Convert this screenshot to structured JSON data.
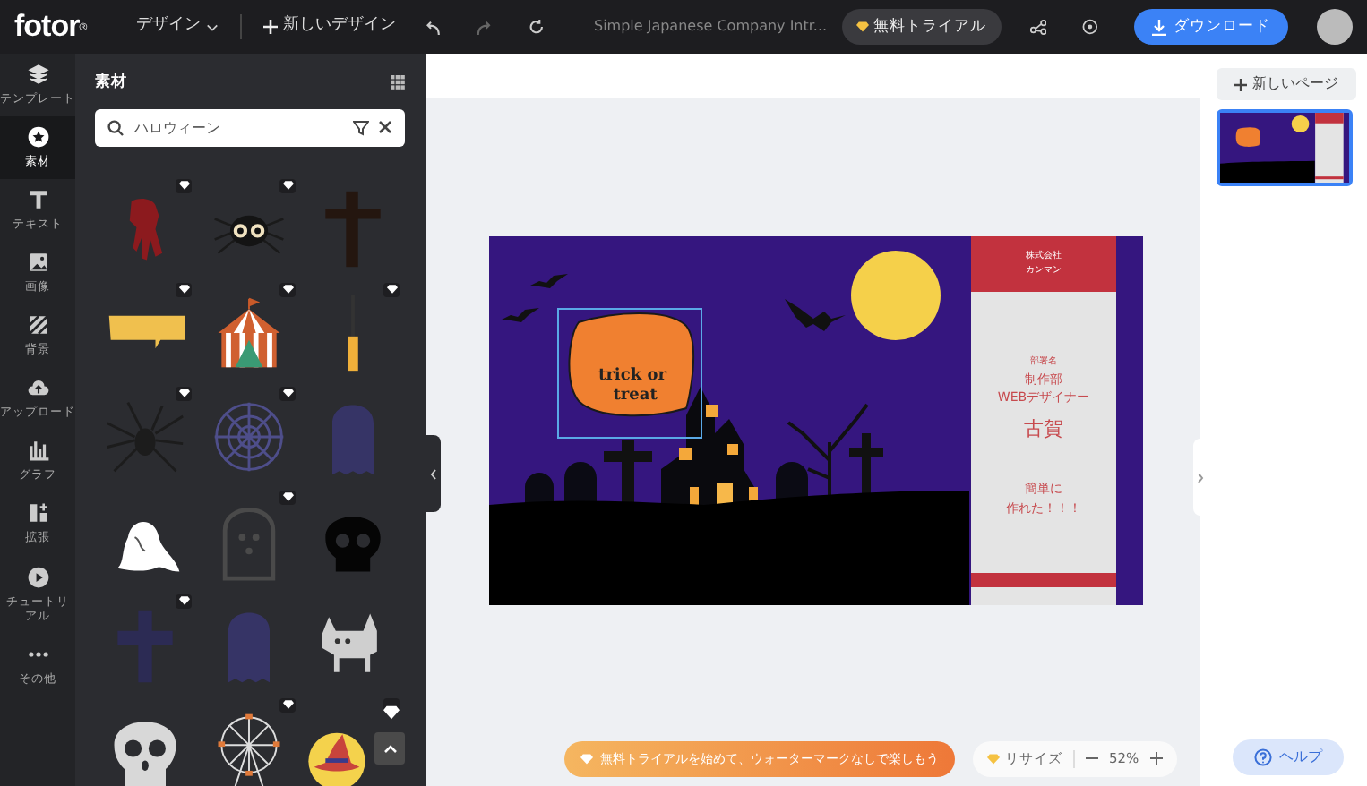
{
  "top_bar": {
    "logo": "fotor",
    "logo_mark": "®",
    "design_menu": "デザイン",
    "new_design": "新しいデザイン",
    "document_title": "Simple Japanese Company Intr...",
    "trial_button": "無料トライアル",
    "download_button": "ダウンロード"
  },
  "rail": [
    {
      "kind": "layers",
      "label": "テンプレート",
      "selected": false
    },
    {
      "kind": "star",
      "label": "素材",
      "selected": true
    },
    {
      "kind": "text",
      "label": "テキスト",
      "selected": false
    },
    {
      "kind": "image",
      "label": "画像",
      "selected": false
    },
    {
      "kind": "stripes",
      "label": "背景",
      "selected": false
    },
    {
      "kind": "cloud",
      "label": "アップロード",
      "selected": false
    },
    {
      "kind": "chart",
      "label": "グラフ",
      "selected": false
    },
    {
      "kind": "apps",
      "label": "拡張",
      "selected": false
    },
    {
      "kind": "play",
      "label": "チュートリアル",
      "selected": false
    },
    {
      "kind": "dots",
      "label": "その他",
      "selected": false
    }
  ],
  "panel": {
    "title": "素材",
    "search": {
      "value": "ハロウィーン"
    },
    "elements": [
      {
        "kind": "blood",
        "premium": true
      },
      {
        "kind": "spider-eyes",
        "premium": true
      },
      {
        "kind": "cross",
        "premium": false
      },
      {
        "kind": "banner",
        "premium": true
      },
      {
        "kind": "circus-tent",
        "premium": true
      },
      {
        "kind": "brush",
        "premium": true
      },
      {
        "kind": "spider",
        "premium": true
      },
      {
        "kind": "web",
        "premium": true
      },
      {
        "kind": "cloth",
        "premium": false
      },
      {
        "kind": "ghost",
        "premium": false
      },
      {
        "kind": "tombstone",
        "premium": true
      },
      {
        "kind": "skull",
        "premium": false
      },
      {
        "kind": "celtic-cross",
        "premium": true
      },
      {
        "kind": "cloth",
        "premium": false
      },
      {
        "kind": "cat",
        "premium": false
      },
      {
        "kind": "skull-white",
        "premium": false
      },
      {
        "kind": "ferris-wheel",
        "premium": true
      },
      {
        "kind": "witch-hat",
        "premium": true
      }
    ]
  },
  "slide": {
    "bubble_text": "trick or treat",
    "company_lines": [
      "株式会社",
      "カンマン"
    ],
    "department_label": "部署名",
    "department": "制作部",
    "role": "WEBデザイナー",
    "person_name": "古賀",
    "message_lines": [
      "簡単に",
      "作れた！！！"
    ]
  },
  "bottom_bar": {
    "trial_banner": "無料トライアルを始めて、ウォーターマークなしで楽しもう",
    "resize": "リサイズ",
    "zoom": "52%"
  },
  "pages": {
    "new_page_button": "新しいページ",
    "thumbnails": [
      {
        "selected": true
      }
    ]
  },
  "help_button": "ヘルプ"
}
